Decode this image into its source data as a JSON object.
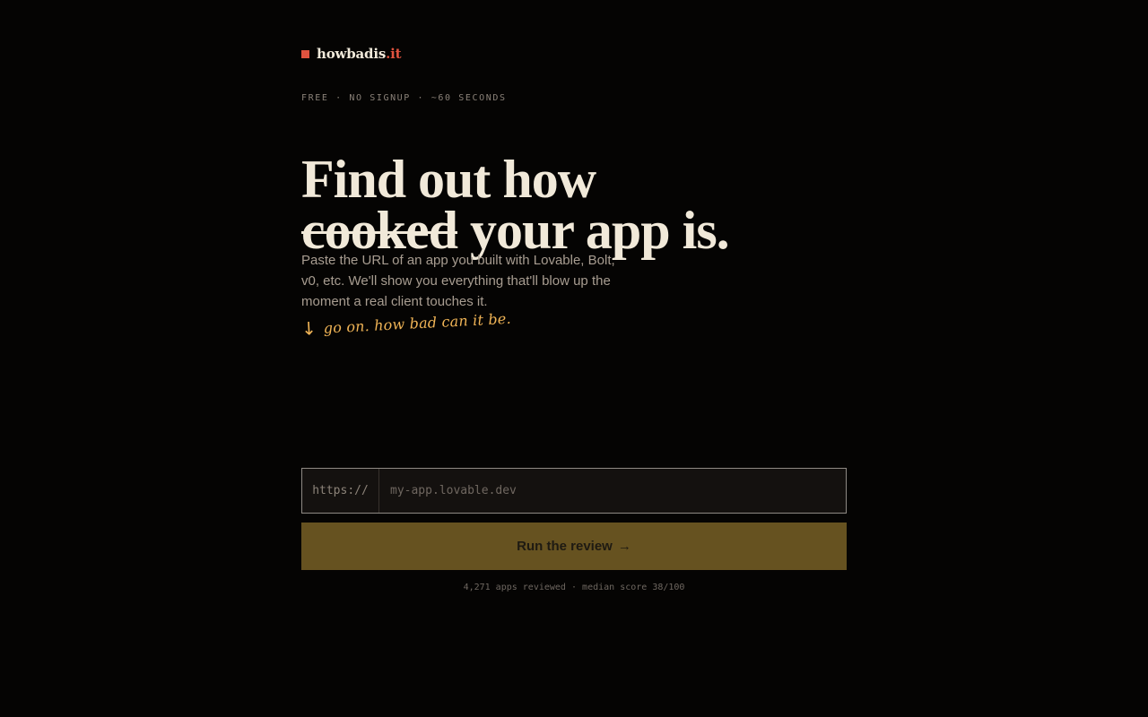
{
  "brand": {
    "name": "howbadis",
    "suffix": ".it"
  },
  "hero": {
    "eyebrow": "FREE · NO SIGNUP · ~60 SECONDS",
    "line1": "Find out how",
    "highlight": "cooked",
    "line2_rest": "your app is.",
    "description": "Paste the URL of an app you built with Lovable, Bolt, v0, etc. We'll show you everything that'll blow up the moment a real client touches it.",
    "note": "go on. how bad can it be.",
    "note_icon": "arrow-down-icon"
  },
  "form": {
    "prefix": "https://",
    "placeholder": "my-app.lovable.dev",
    "value": "",
    "button_label": "Run the review",
    "button_icon": "→"
  },
  "stats": {
    "reviewed": "4,271 apps reviewed",
    "separator": "·",
    "median": "median score 38/100"
  },
  "colors": {
    "background": "#050403",
    "brand_accent": "#e0533f",
    "note_accent": "#f0b456",
    "button": "#665220"
  }
}
